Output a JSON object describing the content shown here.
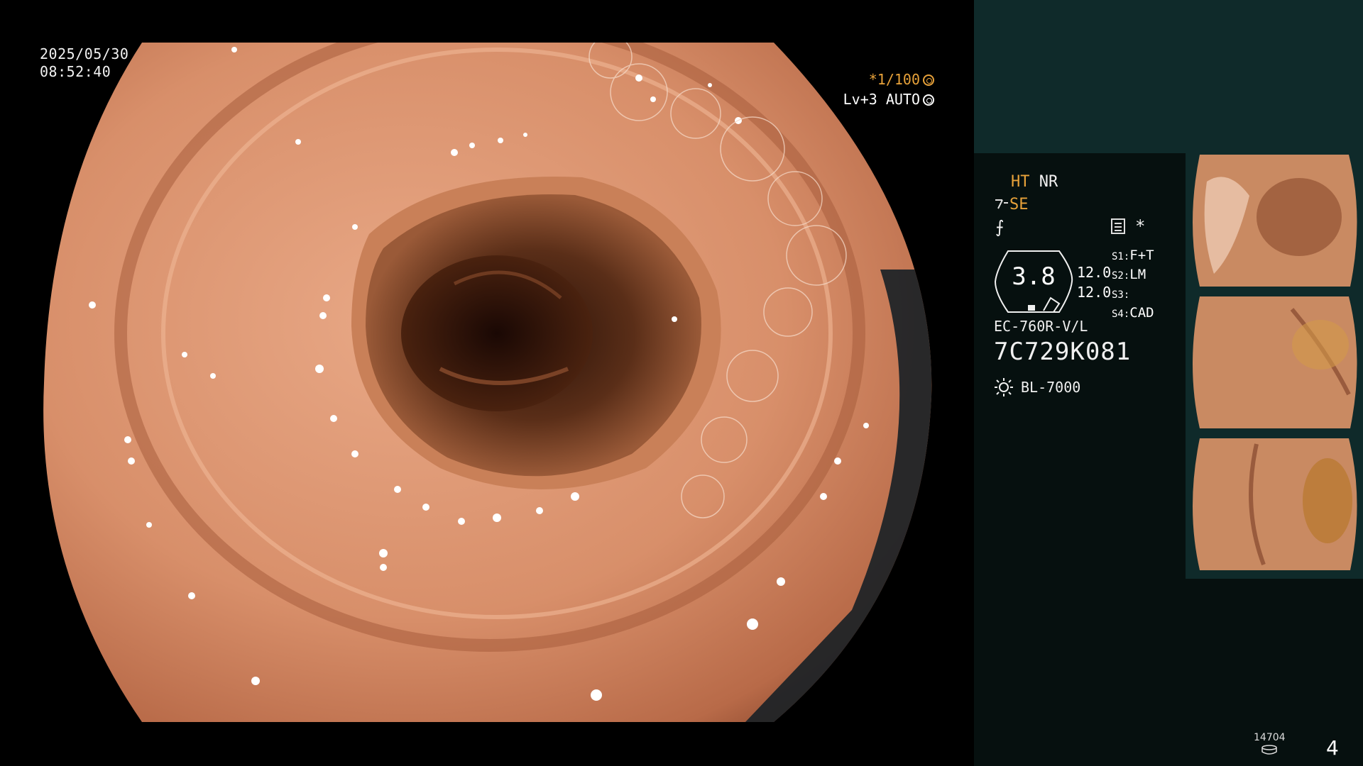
{
  "overlay": {
    "date": "2025/05/30",
    "time": "08:52:40",
    "shutter": "*1/100",
    "level": "Lv+3 AUTO"
  },
  "panel": {
    "mode_ht": "HT",
    "mode_nr": "NR",
    "mode_se": "SE",
    "mode_f": "⨍",
    "asterisk": "*",
    "scope_value": "3.8",
    "lens_a": "12.0",
    "lens_b": "12.0",
    "s1": "S1:",
    "s1_val": "F+T",
    "s2": "S2:",
    "s2_val": "LM",
    "s3": "S3:",
    "s3_val": "",
    "s4": "S4:",
    "s4_val": "CAD",
    "model": "EC-760R-V/L",
    "serial": "7C729K081",
    "light_source": "BL-7000",
    "counter": "14704",
    "page": "4"
  },
  "colors": {
    "accent_orange": "#e8a23a",
    "panel_bg": "#06100f",
    "panel_top": "#0f2a2a"
  },
  "icons": [
    "aperture-icon",
    "auto-iris-icon",
    "menu-icon",
    "sun-icon",
    "disk-icon",
    "scope-icon"
  ]
}
